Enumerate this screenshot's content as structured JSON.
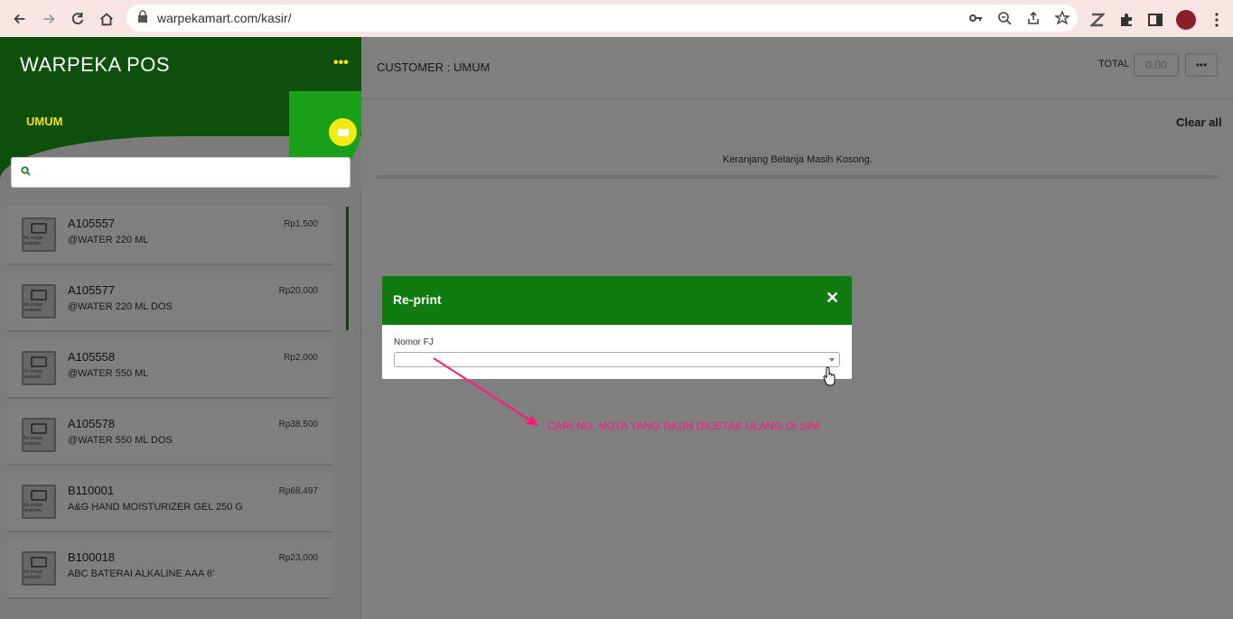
{
  "browser": {
    "url": "warpekamart.com/kasir/"
  },
  "sidebar": {
    "title": "WARPEKA POS",
    "menu_label": "•••",
    "customer": "UMUM",
    "products": [
      {
        "code": "A105557",
        "name": "@WATER 220 ML",
        "price": "Rp1,500",
        "thumb_text": "No image available"
      },
      {
        "code": "A105577",
        "name": "@WATER 220 ML DOS",
        "price": "Rp20,000",
        "thumb_text": "No image available"
      },
      {
        "code": "A105558",
        "name": "@WATER 550 ML",
        "price": "Rp2,000",
        "thumb_text": "No image available"
      },
      {
        "code": "A105578",
        "name": "@WATER 550 ML DOS",
        "price": "Rp38,500",
        "thumb_text": "No image available"
      },
      {
        "code": "B110001",
        "name": "A&G HAND MOISTURIZER GEL 250 G",
        "price": "Rp68,497",
        "thumb_text": "No image available"
      },
      {
        "code": "B100018",
        "name": "ABC BATERAI ALKALINE AAA 6'",
        "price": "Rp23,000",
        "thumb_text": "No image available"
      }
    ]
  },
  "main": {
    "customer_title": "CUSTOMER : UMUM",
    "total_label": "TOTAL",
    "total_value": "0.00",
    "more_label": "•••",
    "clear_all": "Clear all",
    "empty_cart": "Keranjang Belanja Masih Kosong."
  },
  "modal": {
    "title": "Re-print",
    "close_label": "✕",
    "field_label": "Nomor FJ",
    "select_value": ""
  },
  "annotation": "CARI NO. NOTA YANG INGIN DICETAK ULANG DI SINI",
  "colors": {
    "brand_green": "#107c10",
    "customer_yellow": "#f8e100",
    "annotation_pink": "#ff1a7a"
  }
}
